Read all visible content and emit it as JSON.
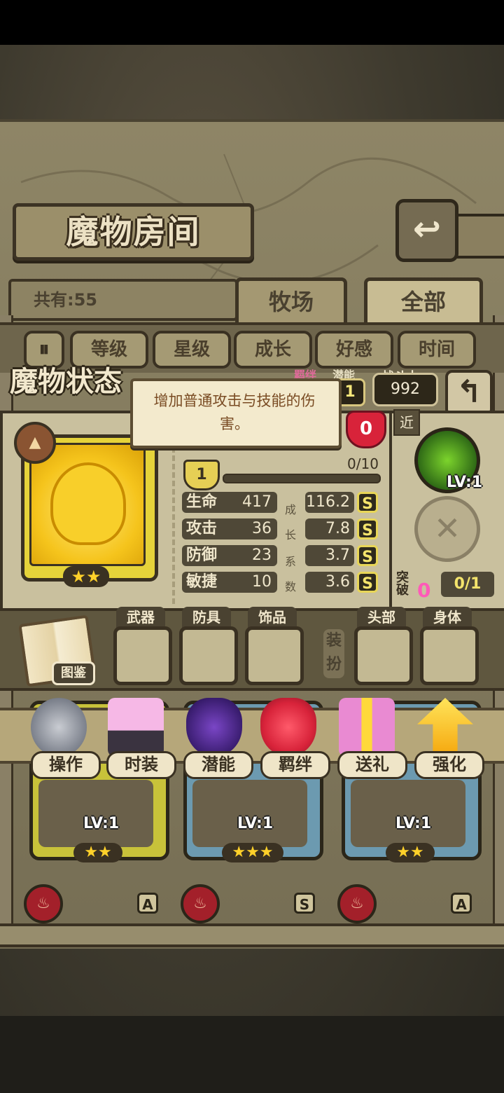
{
  "header": {
    "title": "魔物房间",
    "count_label": "共有:55"
  },
  "tabs": [
    {
      "label": "牧场",
      "active": false
    },
    {
      "label": "全部",
      "active": true
    }
  ],
  "sort_buttons": [
    "等级",
    "星级",
    "成长",
    "好感",
    "时间"
  ],
  "status": {
    "title": "魔物状态",
    "tooltip": "增加普通攻击与技能的伤害。",
    "bond_label": "羁绊",
    "potential_label": "潜能",
    "potential_value": "1",
    "power_label": "战斗力",
    "power_value": "992",
    "heart_value": "0",
    "level_badge": "1",
    "exp": "0/10",
    "growth_chars": [
      "成",
      "长",
      "系",
      "数"
    ],
    "stats": [
      {
        "name": "生命",
        "value": "417",
        "growth": "116.2",
        "grade": "S"
      },
      {
        "name": "攻击",
        "value": "36",
        "growth": "7.8",
        "grade": "S"
      },
      {
        "name": "防御",
        "value": "23",
        "growth": "3.7",
        "grade": "S"
      },
      {
        "name": "敏捷",
        "value": "10",
        "growth": "3.6",
        "grade": "S"
      }
    ],
    "card_stars": "★★"
  },
  "skill": {
    "range_tag": "近",
    "level": "LV:1",
    "break_label": "突破",
    "break_value": "0",
    "break_progress": "0/1"
  },
  "equipment": {
    "book_label": "图鉴",
    "dress_label": "装扮",
    "slots": [
      "武器",
      "防具",
      "饰品",
      "头部",
      "身体"
    ]
  },
  "actions": [
    "操作",
    "时装",
    "潜能",
    "羁绊",
    "送礼",
    "强化"
  ],
  "monster_cards": [
    {
      "level": "LV:1",
      "stars": "★★",
      "color": "#c8c23a"
    },
    {
      "level": "LV:1",
      "stars": "★★★",
      "color": "#6c9ab0"
    },
    {
      "level": "LV:1",
      "stars": "★★",
      "color": "#6c9ab0"
    }
  ],
  "bottom_ranks": [
    "A",
    "S",
    "A"
  ],
  "colors": {
    "accent_gold": "#f4e46c",
    "panel": "#c9c09e",
    "frame": "#3a3122"
  }
}
